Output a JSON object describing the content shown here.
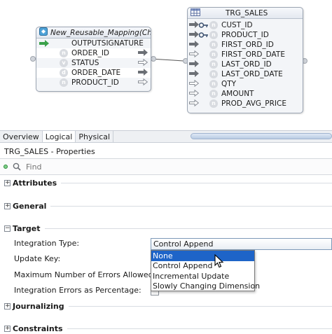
{
  "mapping_node": {
    "title": "New_Reusable_Mapping(Cha",
    "rows": [
      {
        "icon": "output-signature",
        "label": "OUTPUTSIGNATURE"
      },
      {
        "icon": "n",
        "label": "ORDER_ID"
      },
      {
        "icon": "v",
        "label": "STATUS"
      },
      {
        "icon": "d",
        "label": "ORDER_DATE"
      },
      {
        "icon": "n",
        "label": "PRODUCT_ID"
      }
    ]
  },
  "target_node": {
    "title": "TRG_SALES",
    "rows": [
      {
        "icon": "n",
        "label": "CUST_ID",
        "key": true
      },
      {
        "icon": "n",
        "label": "PRODUCT_ID",
        "key": true
      },
      {
        "icon": "n",
        "label": "FIRST_ORD_ID",
        "key": false
      },
      {
        "icon": "n",
        "label": "FIRST_ORD_DATE",
        "key": false
      },
      {
        "icon": "n",
        "label": "LAST_ORD_ID",
        "key": false
      },
      {
        "icon": "n",
        "label": "LAST_ORD_DATE",
        "key": false
      },
      {
        "icon": "n",
        "label": "QTY",
        "key": false
      },
      {
        "icon": "n",
        "label": "AMOUNT",
        "key": false
      },
      {
        "icon": "n",
        "label": "PROD_AVG_PRICE",
        "key": false
      }
    ]
  },
  "tabs": [
    {
      "label": "Overview",
      "active": false
    },
    {
      "label": "Logical",
      "active": true
    },
    {
      "label": "Physical",
      "active": false
    }
  ],
  "properties": {
    "title": "TRG_SALES - Properties",
    "search_placeholder": "Find",
    "sections": {
      "attributes": "Attributes",
      "general": "General",
      "target": "Target",
      "journalizing": "Journalizing",
      "constraints": "Constraints"
    },
    "fields": {
      "integration_type_label": "Integration Type:",
      "update_key_label": "Update Key:",
      "max_errors_label": "Maximum Number of Errors Allowed:",
      "errors_pct_label": "Integration Errors as Percentage:"
    },
    "integration_type_value": "Control Append",
    "dropdown_options": [
      "None",
      "Control Append",
      "Incremental Update",
      "Slowly Changing Dimension"
    ],
    "dropdown_selected": "None"
  },
  "colors": {
    "selection": "#1e64c8",
    "node_border": "#9aa4b2",
    "connector": "#555555"
  }
}
